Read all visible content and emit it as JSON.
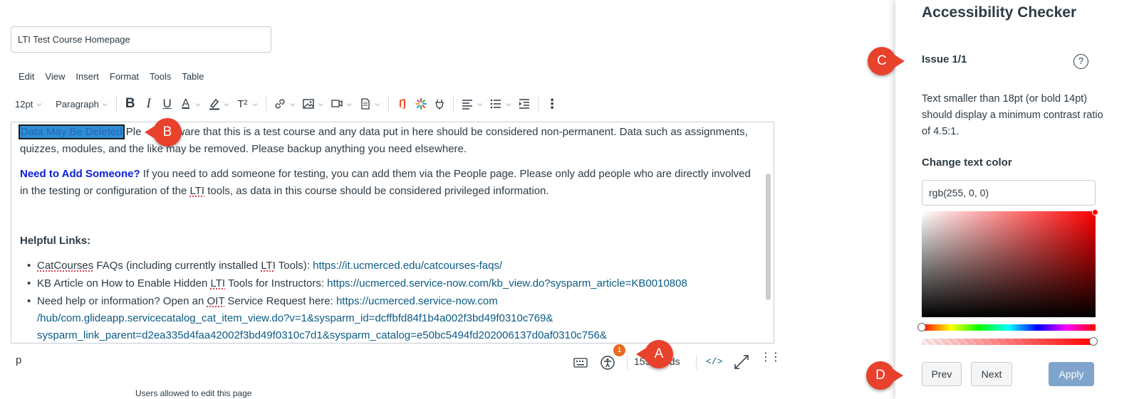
{
  "editor": {
    "title_value": "LTI Test Course Homepage",
    "menu": [
      "Edit",
      "View",
      "Insert",
      "Format",
      "Tools",
      "Table"
    ],
    "toolbar": {
      "font_size": "12pt",
      "block_format": "Paragraph"
    },
    "content": {
      "p1_highlight": "Data May Be Deleted",
      "p1_rest_a": " Ple",
      "p1_rest_b": "ware that this is a test course and any data put in here should be considered non-permanent. Data such as assignments, quizzes, modules, and the like may be removed. Please backup anything you need elsewhere.",
      "p2_strong": "Need to Add Someone?",
      "p2_text_a": "  If you need to add someone for testing, you can add them via the People page. Please only add people who are directly involved in the testing or configuration of the ",
      "p2_lti": "LTI",
      "p2_text_b": " tools, as data in this course should be considered privileged information.",
      "helpful_heading": "Helpful Links:",
      "li1_a": "CatCourses",
      "li1_b": " FAQs (including currently installed ",
      "li1_lti": "LTI",
      "li1_c": " Tools): ",
      "li1_link": "https://it.ucmerced.edu/catcourses-faqs/",
      "li2_a": "KB Article on How to Enable Hidden ",
      "li2_lti": "LTI",
      "li2_b": " Tools for Instructors: ",
      "li2_link": "https://ucmerced.service-now.com/kb_view.do?sysparm_article=KB0010808",
      "li3_a": "Need help or information? Open an ",
      "li3_oit": "OIT",
      "li3_b": " Service Request here: ",
      "li3_link1": "https://ucmerced.service-now.com",
      "li3_link2": "/hub/com.glideapp.servicecatalog_cat_item_view.do?v=1&sysparm_id=dcffbfd84f1b4a002f3bd49f0310c769&",
      "li3_link3": "sysparm_link_parent=d2ea335d4faa42002f3bd49f0310c7d1&sysparm_catalog=e50bc5494fd202006137d0af0310c756&"
    },
    "status": {
      "element_path": "p",
      "a11y_badge_count": "1",
      "word_count": "155 words",
      "html_toggle": "</>",
      "below_text": "Users allowed to edit this page"
    }
  },
  "callouts": {
    "a": "A",
    "b": "B",
    "c": "C",
    "d": "D"
  },
  "checker": {
    "title": "Accessibility Checker",
    "issue": "Issue 1/1",
    "help": "?",
    "description": "Text smaller than 18pt (or bold 14pt) should display a minimum contrast ratio of 4.5:1.",
    "change_label": "Change text color",
    "color_value": "rgb(255, 0, 0)",
    "prev": "Prev",
    "next": "Next",
    "apply": "Apply"
  },
  "colors": {
    "accent": "#e8412c",
    "badge": "#e66a1f",
    "link": "#0b5b84",
    "apply": "#7fa5cc"
  }
}
